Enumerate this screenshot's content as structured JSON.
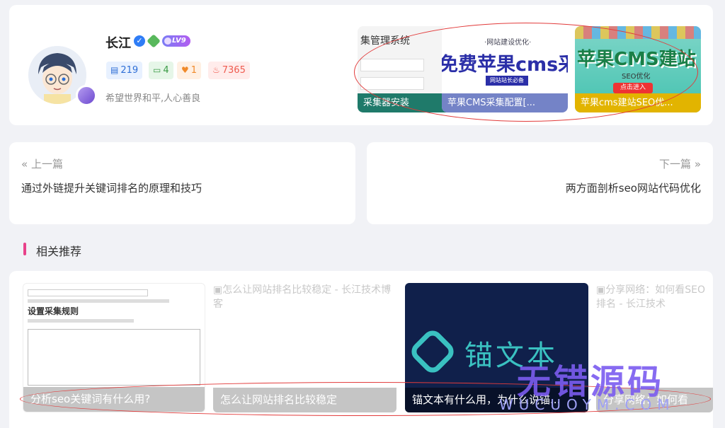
{
  "author": {
    "name": "长江",
    "verified_icon": "verified-check-icon",
    "level": "LV9",
    "stats": {
      "articles": "219",
      "comments": "4",
      "likes": "1",
      "hot": "7365"
    },
    "signature": "希望世界和平,人心善良"
  },
  "author_posts": [
    {
      "caption": "采集器安装",
      "thumb_title": "集管理系统"
    },
    {
      "caption": "苹果CMS采集配置[...",
      "thumb_sub": "·网站建设优化·",
      "thumb_big": "免费苹果cms采集",
      "thumb_tag": "网站站长必备"
    },
    {
      "caption": "苹果cms建站SEO优...",
      "thumb_big": "苹果CMS建站",
      "thumb_seo": "SEO优化",
      "thumb_btn": "点击进入"
    }
  ],
  "nav": {
    "prev_label": "上一篇",
    "prev_title": "通过外链提升关键词排名的原理和技巧",
    "next_label": "下一篇",
    "next_title": "两方面剖析seo网站代码优化"
  },
  "related": {
    "title": "相关推荐",
    "items": [
      {
        "caption": "分析seo关键词有什么用?",
        "thumb_heading": "设置采集规则"
      },
      {
        "caption": "怎么让网站排名比较稳定",
        "alt": "怎么让网站排名比较稳定 - 长江技术博客"
      },
      {
        "caption": "锚文本有什么用，为什么说锚...",
        "thumb_big": "锚文本"
      },
      {
        "caption": "分享网络：如何看",
        "alt": "分享网络：如何看SEO排名 - 长江技术"
      }
    ]
  },
  "watermark": {
    "text": "无错源码",
    "sub": "WUCUOYM.COM"
  },
  "colors": {
    "accent": "#e8428a",
    "annotation": "#e23b3b"
  }
}
